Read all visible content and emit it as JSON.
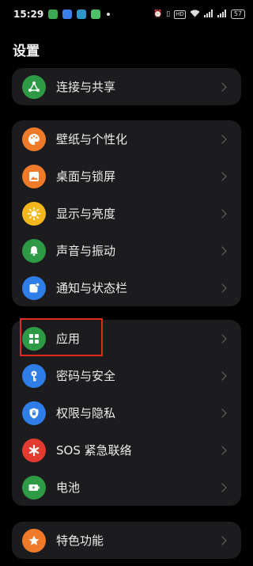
{
  "status_bar": {
    "time": "15:29",
    "hd": "HD",
    "battery": "57"
  },
  "header": {
    "title": "设置"
  },
  "groups": [
    {
      "items": [
        {
          "label": "连接与共享",
          "icon": "share-icon",
          "color": "#2e9a45"
        }
      ]
    },
    {
      "items": [
        {
          "label": "壁纸与个性化",
          "icon": "palette-icon",
          "color": "#ef7a2a"
        },
        {
          "label": "桌面与锁屏",
          "icon": "image-icon",
          "color": "#ef7a2a"
        },
        {
          "label": "显示与亮度",
          "icon": "sun-icon",
          "color": "#f2b71c"
        },
        {
          "label": "声音与振动",
          "icon": "bell-icon",
          "color": "#2e9a45"
        },
        {
          "label": "通知与状态栏",
          "icon": "notification-icon",
          "color": "#2f7ee8"
        }
      ]
    },
    {
      "items": [
        {
          "label": "应用",
          "icon": "apps-grid-icon",
          "color": "#2e9a45"
        },
        {
          "label": "密码与安全",
          "icon": "key-icon",
          "color": "#2f7ee8"
        },
        {
          "label": "权限与隐私",
          "icon": "shield-icon",
          "color": "#2f7ee8"
        },
        {
          "label": "SOS 紧急联络",
          "icon": "asterisk-icon",
          "color": "#e33b2f"
        },
        {
          "label": "电池",
          "icon": "battery-icon",
          "color": "#2e9a45"
        }
      ]
    },
    {
      "items": [
        {
          "label": "特色功能",
          "icon": "star-icon",
          "color": "#ef7a2a"
        }
      ]
    }
  ],
  "highlight": {
    "target": "应用",
    "color": "#e02a20"
  }
}
